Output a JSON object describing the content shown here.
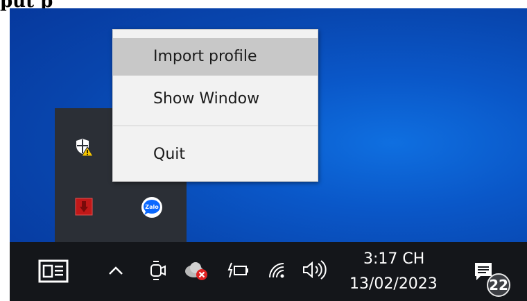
{
  "caption": {
    "text": "put p"
  },
  "context_menu": {
    "items": [
      {
        "label": "Import profile",
        "state": "highlighted"
      },
      {
        "label": "Show Window",
        "state": "normal"
      },
      {
        "label": "Quit",
        "state": "normal"
      }
    ]
  },
  "tray_overflow": {
    "icons": [
      {
        "name": "windows-security-warning-icon"
      },
      {
        "name": "red-app-icon"
      },
      {
        "name": "zalo-icon",
        "label": "Zalo"
      }
    ]
  },
  "taskbar": {
    "icons": [
      {
        "name": "news-widget-icon"
      },
      {
        "name": "chevron-up-icon"
      },
      {
        "name": "meet-now-icon"
      },
      {
        "name": "cloud-error-icon"
      },
      {
        "name": "battery-icon"
      },
      {
        "name": "wifi-icon"
      },
      {
        "name": "volume-icon"
      }
    ],
    "clock": {
      "time": "3:17 CH",
      "date": "13/02/2023"
    },
    "notifications": {
      "count": "22"
    }
  },
  "colors": {
    "desktop_blue": "#0a57c8",
    "taskbar": "#14161a",
    "tray_panel": "#2b2f36",
    "menu_background": "#f2f2f2",
    "menu_highlight": "#c8c8c8"
  }
}
